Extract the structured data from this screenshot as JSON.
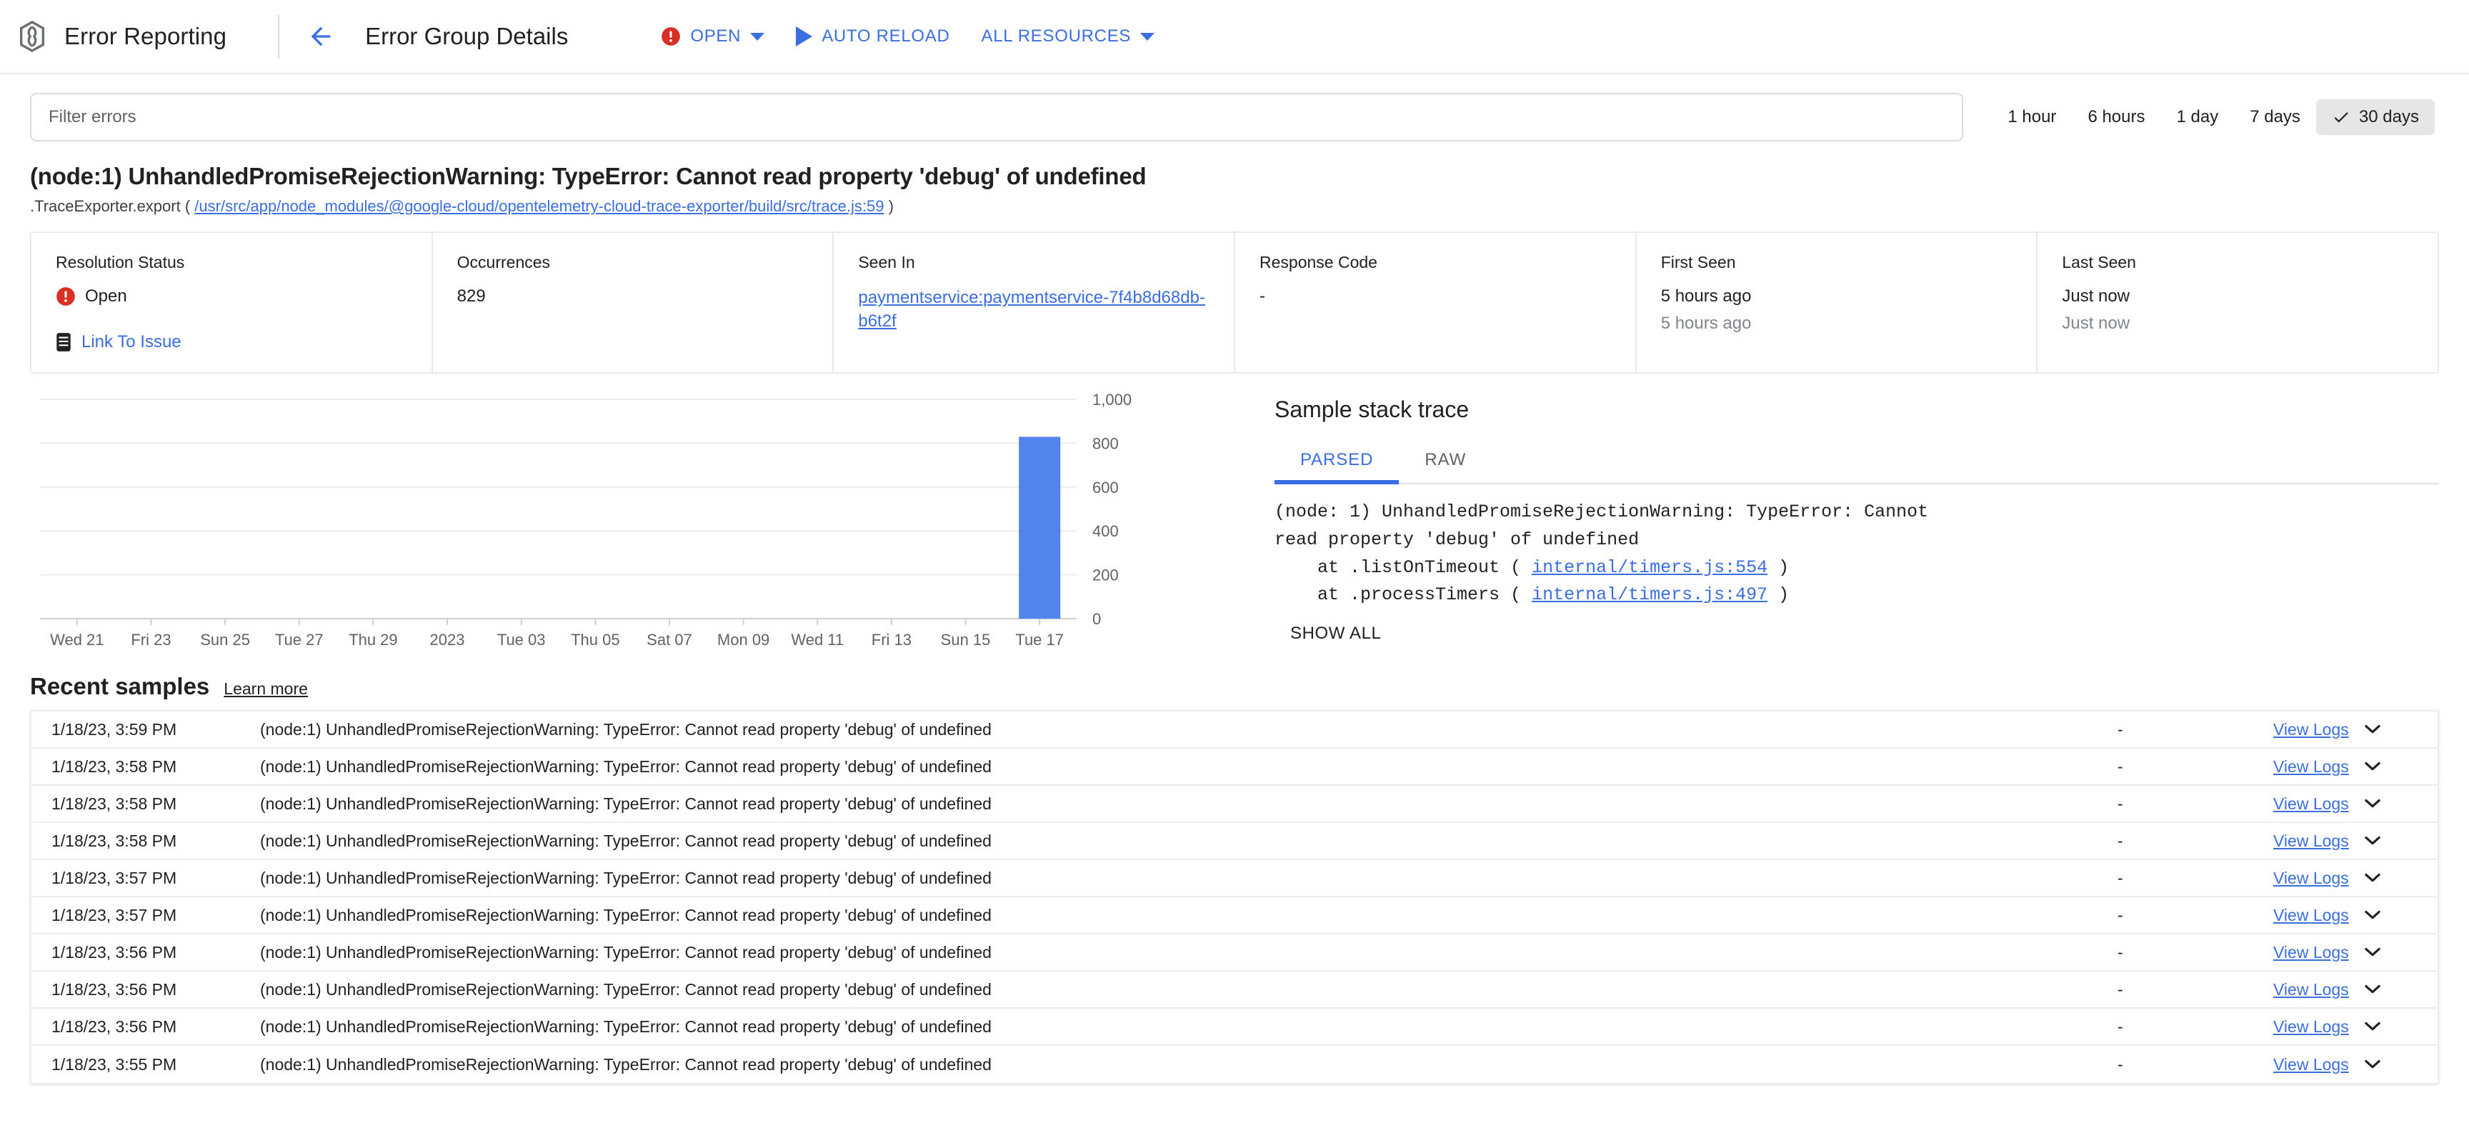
{
  "appbar": {
    "logo_icon": "error-reporting-logo",
    "product_name": "Error Reporting",
    "back_icon": "back-arrow-icon",
    "page_title": "Error Group Details",
    "actions": [
      {
        "label": "OPEN",
        "icon": "error-status-icon",
        "has_caret": true
      },
      {
        "label": "AUTO RELOAD",
        "icon": "play-icon",
        "has_caret": false
      },
      {
        "label": "ALL RESOURCES",
        "icon": "",
        "has_caret": true
      }
    ]
  },
  "filter": {
    "placeholder": "Filter errors",
    "value": ""
  },
  "time_ranges": [
    {
      "label": "1 hour",
      "active": false
    },
    {
      "label": "6 hours",
      "active": false
    },
    {
      "label": "1 day",
      "active": false
    },
    {
      "label": "7 days",
      "active": false
    },
    {
      "label": "30 days",
      "active": true
    }
  ],
  "error": {
    "title": "(node:1) UnhandledPromiseRejectionWarning: TypeError: Cannot read property 'debug' of undefined",
    "subtitle_fn": ".TraceExporter.export",
    "subtitle_open_paren": "(",
    "subtitle_link": "/usr/src/app/node_modules/@google-cloud/opentelemetry-cloud-trace-exporter/build/src/trace.js:59",
    "subtitle_close_paren": ")"
  },
  "metadata": [
    {
      "label": "Resolution Status",
      "value": "Open",
      "icon": "error-status-icon",
      "action_label": "Link To Issue",
      "action_icon": "issue-icon"
    },
    {
      "label": "Occurrences",
      "value": "829"
    },
    {
      "label": "Seen In",
      "link": "paymentservice:paymentservice-7f4b8d68db-b6t2f"
    },
    {
      "label": "Response Code",
      "value": "-"
    },
    {
      "label": "First Seen",
      "value": "5 hours ago",
      "sub": "5 hours ago"
    },
    {
      "label": "Last Seen",
      "value": "Just now",
      "sub": "Just now"
    }
  ],
  "chart_data": {
    "type": "bar",
    "title": "",
    "xlabel": "",
    "ylabel": "",
    "categories": [
      "Wed 21",
      "Fri 23",
      "Sun 25",
      "Tue 27",
      "Thu 29",
      "2023",
      "Tue 03",
      "Thu 05",
      "Sat 07",
      "Mon 09",
      "Wed 11",
      "Fri 13",
      "Sun 15",
      "Tue 17"
    ],
    "tick_labels_x": [
      "Wed 21",
      "Fri 23",
      "Sun 25",
      "Tue 27",
      "Thu 29",
      "2023",
      "Tue 03",
      "Thu 05",
      "Sat 07",
      "Mon 09",
      "Wed 11",
      "Fri 13",
      "Sun 15",
      "Tue 17"
    ],
    "tick_labels_y": [
      "0",
      "200",
      "400",
      "600",
      "800",
      "1,000"
    ],
    "values": [
      0,
      0,
      0,
      0,
      0,
      0,
      0,
      0,
      0,
      0,
      0,
      0,
      0,
      829
    ],
    "ylim": [
      0,
      1000
    ],
    "grid": true,
    "legend": "none",
    "bar_color": "#5185ec"
  },
  "stack_trace": {
    "heading": "Sample stack trace",
    "tabs": [
      {
        "label": "PARSED",
        "active": true
      },
      {
        "label": "RAW",
        "active": false
      }
    ],
    "line1": "(node: 1) UnhandledPromiseRejectionWarning: TypeError: Cannot",
    "line2": "read property 'debug' of undefined",
    "frames": [
      {
        "prefix": "    at .listOnTimeout ( ",
        "link": "internal/timers.js:554",
        "suffix": " )"
      },
      {
        "prefix": "    at .processTimers ( ",
        "link": "internal/timers.js:497",
        "suffix": " )"
      }
    ],
    "show_all": "SHOW ALL"
  },
  "recent_samples": {
    "title": "Recent samples",
    "learn_more": "Learn more",
    "action_label": "View Logs",
    "chevron_icon": "chevron-down-icon",
    "rows": [
      {
        "time": "1/18/23, 3:59 PM",
        "message": "(node:1) UnhandledPromiseRejectionWarning: TypeError: Cannot read property 'debug' of undefined",
        "response": "-"
      },
      {
        "time": "1/18/23, 3:58 PM",
        "message": "(node:1) UnhandledPromiseRejectionWarning: TypeError: Cannot read property 'debug' of undefined",
        "response": "-"
      },
      {
        "time": "1/18/23, 3:58 PM",
        "message": "(node:1) UnhandledPromiseRejectionWarning: TypeError: Cannot read property 'debug' of undefined",
        "response": "-"
      },
      {
        "time": "1/18/23, 3:58 PM",
        "message": "(node:1) UnhandledPromiseRejectionWarning: TypeError: Cannot read property 'debug' of undefined",
        "response": "-"
      },
      {
        "time": "1/18/23, 3:57 PM",
        "message": "(node:1) UnhandledPromiseRejectionWarning: TypeError: Cannot read property 'debug' of undefined",
        "response": "-"
      },
      {
        "time": "1/18/23, 3:57 PM",
        "message": "(node:1) UnhandledPromiseRejectionWarning: TypeError: Cannot read property 'debug' of undefined",
        "response": "-"
      },
      {
        "time": "1/18/23, 3:56 PM",
        "message": "(node:1) UnhandledPromiseRejectionWarning: TypeError: Cannot read property 'debug' of undefined",
        "response": "-"
      },
      {
        "time": "1/18/23, 3:56 PM",
        "message": "(node:1) UnhandledPromiseRejectionWarning: TypeError: Cannot read property 'debug' of undefined",
        "response": "-"
      },
      {
        "time": "1/18/23, 3:56 PM",
        "message": "(node:1) UnhandledPromiseRejectionWarning: TypeError: Cannot read property 'debug' of undefined",
        "response": "-"
      },
      {
        "time": "1/18/23, 3:55 PM",
        "message": "(node:1) UnhandledPromiseRejectionWarning: TypeError: Cannot read property 'debug' of undefined",
        "response": "-"
      }
    ]
  },
  "colors": {
    "accent_blue": "#3b6ee0",
    "error_red": "#d93025",
    "bar_blue": "#5185ec",
    "text_primary": "#202124",
    "text_secondary": "#5f6368"
  }
}
